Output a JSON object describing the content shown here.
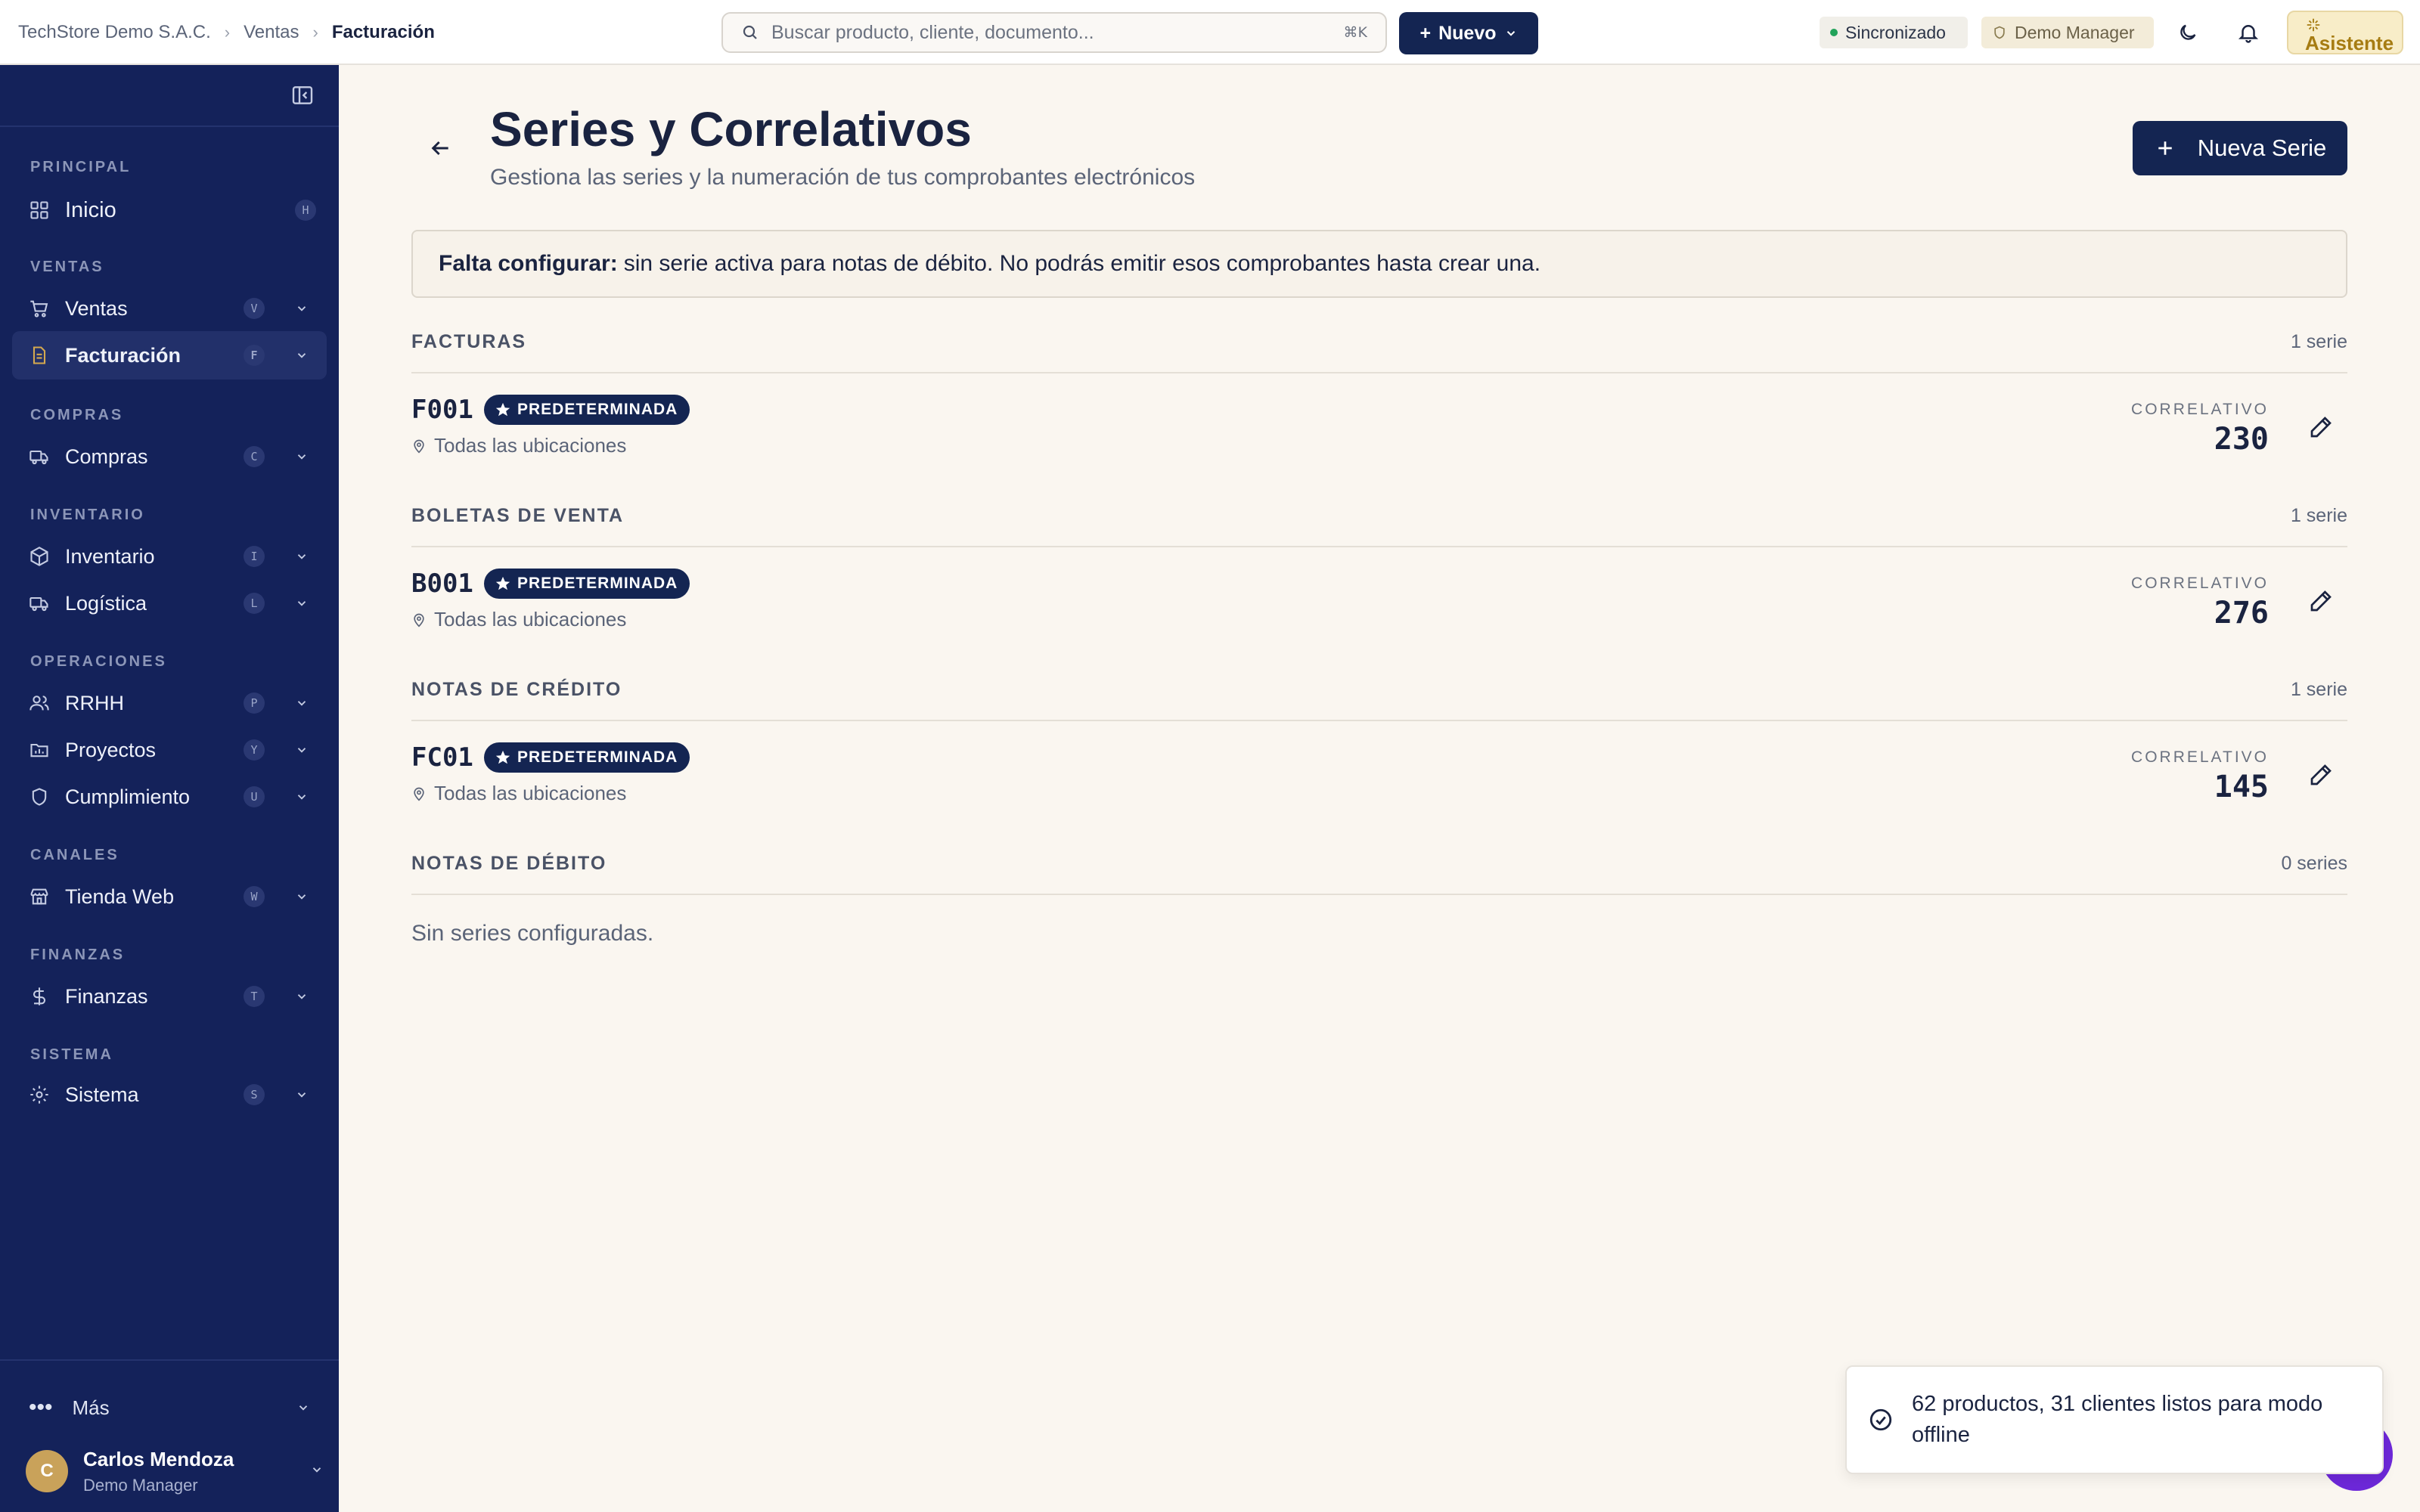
{
  "breadcrumb": {
    "company": "TechStore Demo S.A.C.",
    "section": "Ventas",
    "current": "Facturación"
  },
  "search": {
    "placeholder": "Buscar producto, cliente, documento...",
    "shortcut": "⌘K"
  },
  "header": {
    "new_label": "Nuevo",
    "sync_label": "Sincronizado",
    "role_label": "Demo Manager",
    "assistant_label": "Asistente"
  },
  "sidebar": {
    "groups": [
      "PRINCIPAL",
      "VENTAS",
      "COMPRAS",
      "INVENTARIO",
      "OPERACIONES",
      "CANALES",
      "FINANZAS",
      "SISTEMA"
    ],
    "items": [
      {
        "label": "Inicio",
        "key": "H"
      },
      {
        "label": "Ventas",
        "key": "V"
      },
      {
        "label": "Facturación",
        "key": "F"
      },
      {
        "label": "Compras",
        "key": "C"
      },
      {
        "label": "Inventario",
        "key": "I"
      },
      {
        "label": "Logística",
        "key": "L"
      },
      {
        "label": "RRHH",
        "key": "P"
      },
      {
        "label": "Proyectos",
        "key": "Y"
      },
      {
        "label": "Cumplimiento",
        "key": "U"
      },
      {
        "label": "Tienda Web",
        "key": "W"
      },
      {
        "label": "Finanzas",
        "key": "T"
      },
      {
        "label": "Sistema",
        "key": "S"
      }
    ],
    "more_label": "Más",
    "user": {
      "initial": "C",
      "name": "Carlos Mendoza",
      "role": "Demo Manager"
    }
  },
  "page": {
    "title": "Series y Correlativos",
    "subtitle": "Gestiona las series y la numeración de tus comprobantes electrónicos",
    "new_series_label": "Nueva Serie",
    "alert_bold": "Falta configurar:",
    "alert_text": "sin serie activa para notas de débito. No podrás emitir esos comprobantes hasta crear una."
  },
  "sections": [
    {
      "title": "FACTURAS",
      "count": "1 serie",
      "code": "F001",
      "badge": "PREDETERMINADA",
      "location": "Todas las ubicaciones",
      "corr_label": "CORRELATIVO",
      "corr_value": "230"
    },
    {
      "title": "BOLETAS DE VENTA",
      "count": "1 serie",
      "code": "B001",
      "badge": "PREDETERMINADA",
      "location": "Todas las ubicaciones",
      "corr_label": "CORRELATIVO",
      "corr_value": "276"
    },
    {
      "title": "NOTAS DE CRÉDITO",
      "count": "1 serie",
      "code": "FC01",
      "badge": "PREDETERMINADA",
      "location": "Todas las ubicaciones",
      "corr_label": "CORRELATIVO",
      "corr_value": "145"
    },
    {
      "title": "NOTAS DE DÉBITO",
      "count": "0 series",
      "empty": "Sin series configuradas."
    }
  ],
  "toast": {
    "text": "62 productos, 31 clientes listos para modo offline"
  },
  "colors": {
    "navy": "#142552",
    "accent": "#c9a25a",
    "sync": "#22a35a",
    "fab": "#6d28d9"
  }
}
